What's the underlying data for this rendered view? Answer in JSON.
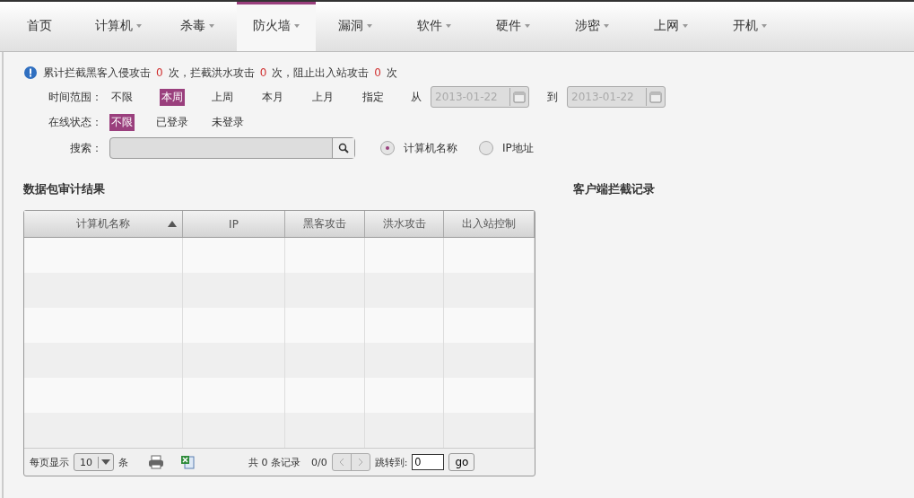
{
  "tabs": [
    {
      "label": "首页",
      "selected": false,
      "dropdown": false
    },
    {
      "label": "计算机",
      "selected": false,
      "dropdown": true
    },
    {
      "label": "杀毒",
      "selected": false,
      "dropdown": true
    },
    {
      "label": "防火墙",
      "selected": true,
      "dropdown": true
    },
    {
      "label": "漏洞",
      "selected": false,
      "dropdown": true
    },
    {
      "label": "软件",
      "selected": false,
      "dropdown": true
    },
    {
      "label": "硬件",
      "selected": false,
      "dropdown": true
    },
    {
      "label": "涉密",
      "selected": false,
      "dropdown": true
    },
    {
      "label": "上网",
      "selected": false,
      "dropdown": true
    },
    {
      "label": "开机",
      "selected": false,
      "dropdown": true
    }
  ],
  "summary": [
    {
      "kind": "text",
      "text": "累计拦截黑客入侵攻击"
    },
    {
      "kind": "count",
      "text": "0"
    },
    {
      "kind": "text",
      "text": "次，拦截洪水攻击"
    },
    {
      "kind": "count",
      "text": "0"
    },
    {
      "kind": "text",
      "text": "次，阻止出入站攻击"
    },
    {
      "kind": "count",
      "text": "0"
    },
    {
      "kind": "text",
      "text": "次"
    }
  ],
  "time_range": {
    "label": "时间范围：",
    "options": [
      {
        "label": "不限",
        "selected": false
      },
      {
        "label": "本周",
        "selected": true
      },
      {
        "label": "上周",
        "selected": false
      },
      {
        "label": "本月",
        "selected": false
      },
      {
        "label": "上月",
        "selected": false
      },
      {
        "label": "指定",
        "selected": false
      }
    ],
    "from_label": "从",
    "from_value": "2013-01-22",
    "to_label": "到",
    "to_value": "2013-01-22"
  },
  "online_status": {
    "label": "在线状态：",
    "options": [
      {
        "label": "不限",
        "selected": true
      },
      {
        "label": "已登录",
        "selected": false
      },
      {
        "label": "未登录",
        "selected": false
      }
    ]
  },
  "search": {
    "label": "搜索：",
    "options": [
      {
        "label": "计算机名称",
        "selected": true
      },
      {
        "label": "IP地址",
        "selected": false
      }
    ]
  },
  "left_title": "数据包审计结果",
  "right_title": "客户端拦截记录",
  "table": {
    "columns": [
      {
        "label": "计算机名称",
        "sorted": true
      },
      {
        "label": "IP",
        "sorted": false
      },
      {
        "label": "黑客攻击",
        "sorted": false
      },
      {
        "label": "洪水攻击",
        "sorted": false
      },
      {
        "label": "出入站控制",
        "sorted": false
      }
    ]
  },
  "pager": {
    "per_page_label": "每页显示",
    "per_page": "10",
    "unit": "条",
    "total": "共 0 条记录",
    "pages": "0/0",
    "jump_label": "跳转到:",
    "jump_value": "0",
    "go": "go"
  }
}
